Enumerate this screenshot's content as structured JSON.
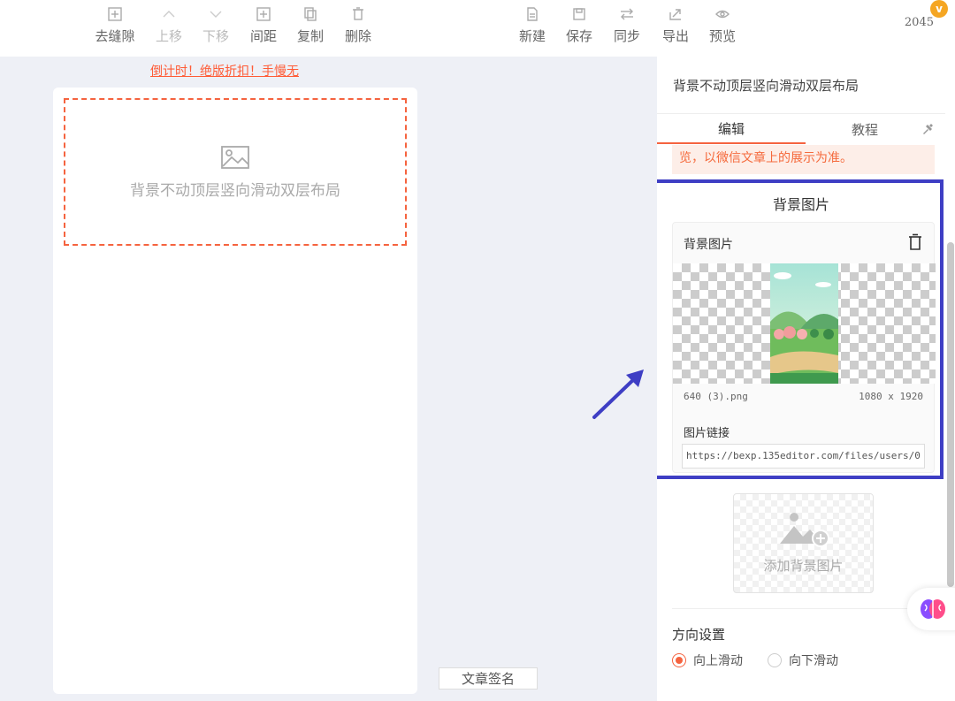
{
  "toolbar": {
    "left": [
      {
        "label": "去缝隙",
        "icon": "plus-square-icon",
        "enabled": true
      },
      {
        "label": "上移",
        "icon": "chevron-up-icon",
        "enabled": false
      },
      {
        "label": "下移",
        "icon": "chevron-down-icon",
        "enabled": false
      },
      {
        "label": "间距",
        "icon": "plus-square-icon",
        "enabled": true
      },
      {
        "label": "复制",
        "icon": "copy-icon",
        "enabled": true
      },
      {
        "label": "删除",
        "icon": "trash-icon",
        "enabled": true
      }
    ],
    "right": [
      {
        "label": "新建",
        "icon": "document-icon",
        "enabled": true
      },
      {
        "label": "保存",
        "icon": "save-icon",
        "enabled": true
      },
      {
        "label": "同步",
        "icon": "sync-icon",
        "enabled": true
      },
      {
        "label": "导出",
        "icon": "export-icon",
        "enabled": true
      },
      {
        "label": "预览",
        "icon": "eye-icon",
        "enabled": true
      }
    ],
    "badge": "v",
    "count": "2045"
  },
  "promo_text": "倒计时！绝版折扣！手慢无",
  "canvas": {
    "block_label": "背景不动顶层竖向滑动双层布局",
    "sign_button": "文章签名"
  },
  "panel": {
    "title": "背景不动顶层竖向滑动双层布局",
    "tabs": {
      "edit": "编辑",
      "tutorial": "教程"
    },
    "notice": "览，以微信文章上的展示为准。",
    "section_title": "背景图片",
    "card": {
      "title": "背景图片",
      "file_name": "640 (3).png",
      "file_size": "1080 x 1920",
      "link_label": "图片链接",
      "link_value": "https://bexp.135editor.com/files/users/0"
    },
    "add_bg_label": "添加背景图片",
    "direction": {
      "title": "方向设置",
      "options": [
        "向上滑动",
        "向下滑动"
      ],
      "selected": "向上滑动"
    }
  },
  "colors": {
    "accent": "#f5633f",
    "highlight": "#3e3ec4",
    "badge": "#f5a623",
    "page_bg": "#eef0f6"
  }
}
